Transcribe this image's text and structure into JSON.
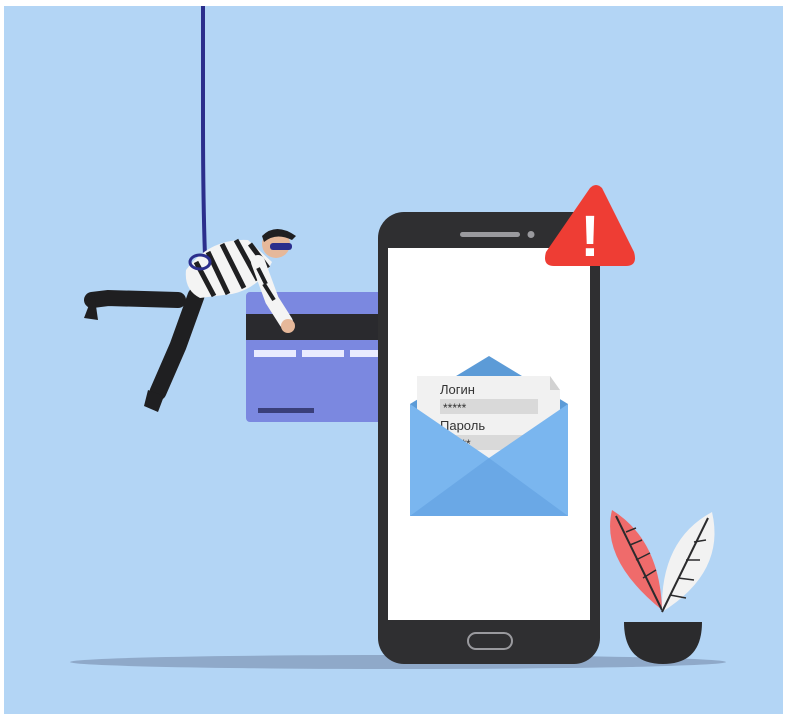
{
  "letter": {
    "login_label": "Логин",
    "login_value": "*****",
    "password_label": "Пароль",
    "password_value": "****"
  },
  "alert": {
    "symbol": "!"
  },
  "colors": {
    "background": "#b3d5f5",
    "phone_body": "#2f2f31",
    "phone_screen": "#ffffff",
    "card": "#7b88e0",
    "card_stripe": "#2a2a2e",
    "envelope_back": "#5c9bd7",
    "envelope_front": "#7ab6ef",
    "letter_paper": "#f1f1f1",
    "field_bg": "#d9d9d9",
    "alert_red": "#ee3d34",
    "plant_red": "#ef6b6b",
    "plant_white": "#f2f2f2",
    "pot": "#2b2b2d",
    "rope": "#2b2e8c",
    "shadow": "#8fa9c9"
  }
}
